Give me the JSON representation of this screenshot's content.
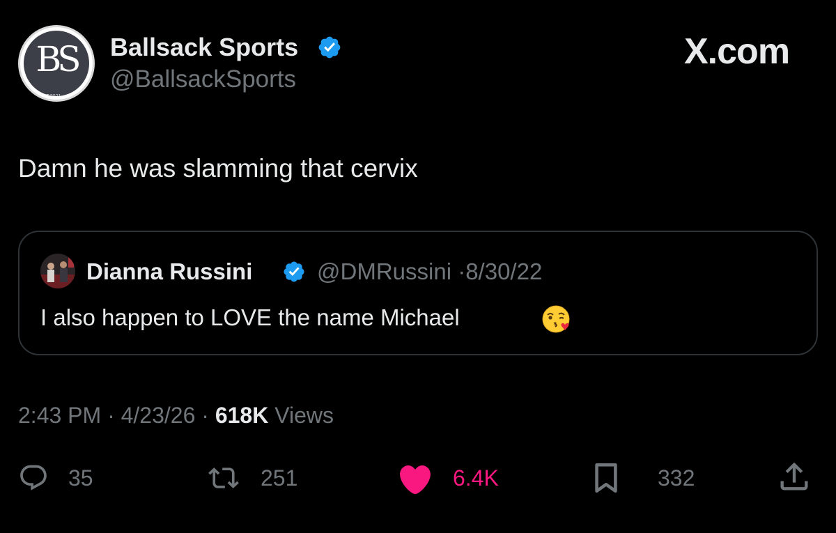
{
  "author": {
    "display_name": "Ballsack Sports",
    "handle": "@BallsackSports",
    "avatar_monogram": "BS",
    "avatar_small_text": "EST.2021",
    "verified": true
  },
  "brand": {
    "site_label": "X.com"
  },
  "tweet": {
    "text": "Damn he was slamming that cervix"
  },
  "quoted_tweet": {
    "display_name": "Dianna Russini",
    "handle": "@DMRussini",
    "separator": "·",
    "date": "8/30/22",
    "text": "I also happen to LOVE the name Michael",
    "emoji": "kissing-face-with-heart-icon",
    "verified": true
  },
  "meta": {
    "time": "2:43 PM",
    "date": "4/23/26",
    "views_count": "618K",
    "views_label": "Views",
    "separator": "·"
  },
  "actions": {
    "replies": "35",
    "reposts": "251",
    "likes": "6.4K",
    "bookmarks": "332"
  },
  "colors": {
    "background": "#000000",
    "text_primary": "#e7e9ea",
    "text_secondary": "#71767b",
    "verified_blue": "#1d9bf0",
    "like_pink": "#f91880",
    "border": "#2f3336"
  },
  "icons": {
    "reply": "reply-bubble-icon",
    "repost": "repost-icon",
    "like": "heart-icon",
    "bookmark": "bookmark-icon",
    "share": "share-upload-icon",
    "verified": "verified-badge-icon"
  }
}
